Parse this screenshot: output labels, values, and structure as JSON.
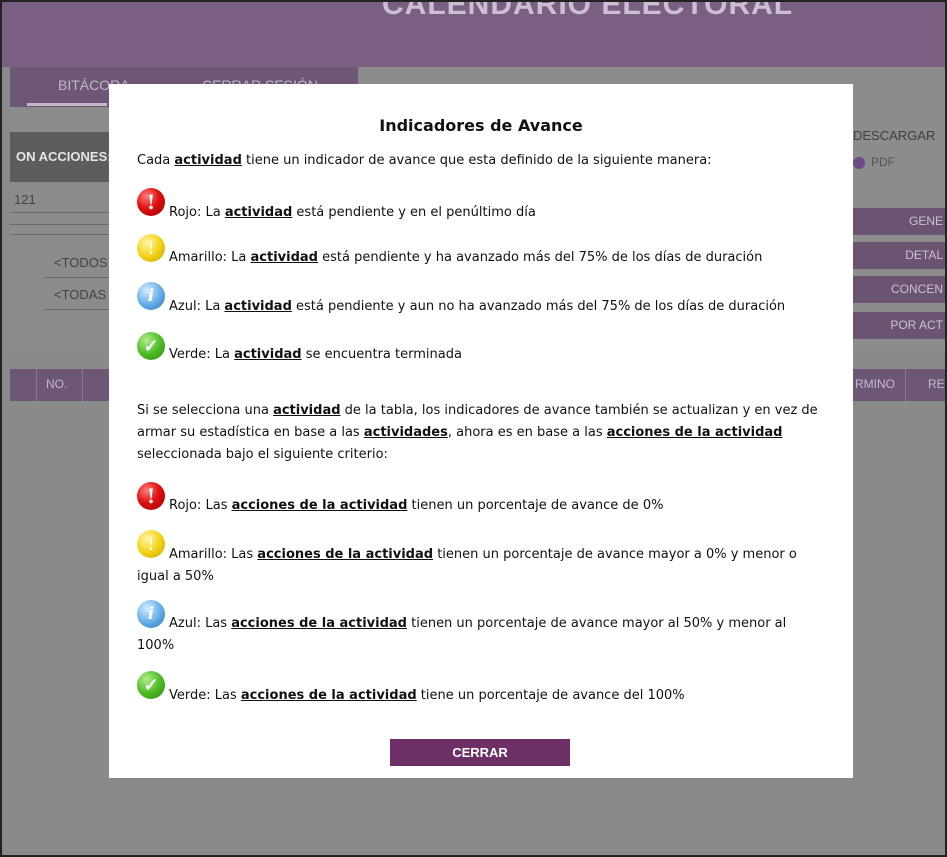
{
  "app": {
    "header_title": "CALENDARIO ELECTORAL",
    "nav": {
      "bitacora": "BITÁCORA",
      "cerrar_sesion": "CERRAR SESIÓN"
    },
    "acciones_label": "ON ACCIONES:",
    "filter_value": "121",
    "todos": "<TODOS",
    "todas": "<TODAS",
    "descargar": "DESCARGAR",
    "pdf": "PDF",
    "side_buttons": [
      "GENE",
      "DETAL",
      "CONCEN",
      "POR ACT"
    ],
    "table_headers": {
      "no": "NO.",
      "termino": "RMINO",
      "res": "RES"
    }
  },
  "modal": {
    "title": "Indicadores de Avance",
    "intro": {
      "pre": "Cada ",
      "kw": "actividad",
      "post": " tiene un indicador de avance que esta definido de la siguiente manera:"
    },
    "indicators": [
      {
        "icon": "red-exclamation-icon",
        "pre": "Rojo: La ",
        "kw": "actividad",
        "post": " está pendiente y en el penúltimo día"
      },
      {
        "icon": "yellow-exclamation-icon",
        "pre": "Amarillo: La ",
        "kw": "actividad",
        "post": " está pendiente y ha avanzado más del 75% de los días de duración"
      },
      {
        "icon": "blue-info-icon",
        "pre": "Azul: La ",
        "kw": "actividad",
        "post": " está pendiente y aun no ha avanzado más del 75% de los días de duración"
      },
      {
        "icon": "green-check-icon",
        "pre": "Verde: La ",
        "kw": "actividad",
        "post": " se encuentra terminada"
      }
    ],
    "paragraph2": {
      "t1": "Si se selecciona una ",
      "k1": "actividad",
      "t2": " de la tabla, los indicadores de avance también se actualizan y en vez de armar su estadística en base a las ",
      "k2": "actividades",
      "t3": ", ahora es en base a las ",
      "k3": "acciones de la actividad",
      "t4": " seleccionada bajo el siguiente criterio:"
    },
    "indicators2": [
      {
        "icon": "red-exclamation-icon",
        "pre": "Rojo: Las ",
        "kw": "acciones de la actividad",
        "post": " tienen un porcentaje de avance de 0%"
      },
      {
        "icon": "yellow-exclamation-icon",
        "pre": "Amarillo: Las ",
        "kw": "acciones de la actividad",
        "post": " tienen un porcentaje de avance mayor a 0% y menor o igual a 50%"
      },
      {
        "icon": "blue-info-icon",
        "pre": "Azul: Las ",
        "kw": "acciones de la actividad",
        "post": " tienen un porcentaje de avance mayor al 50% y menor al 100%"
      },
      {
        "icon": "green-check-icon",
        "pre": "Verde: Las ",
        "kw": "acciones de la actividad",
        "post": " tiene un porcentaje de avance del 100%"
      }
    ],
    "close_label": "CERRAR"
  }
}
